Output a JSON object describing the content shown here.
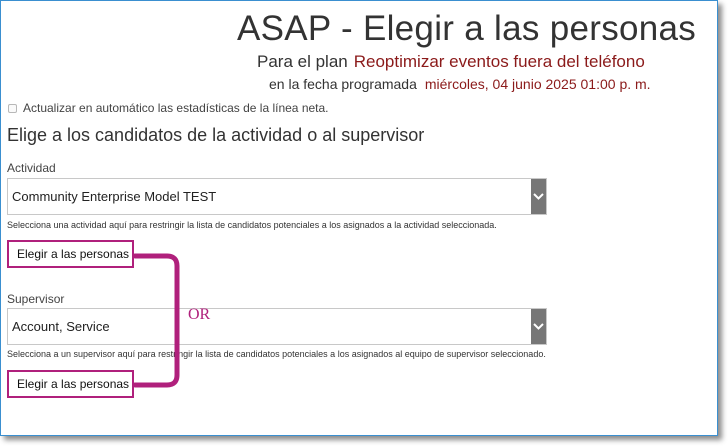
{
  "header": {
    "title": "ASAP - Elegir a las personas",
    "plan_label": "Para el plan",
    "plan_value": "Reoptimizar eventos fuera del teléfono",
    "date_label": "en la fecha programada",
    "date_value": "miércoles, 04 junio 2025 01:00 p. m."
  },
  "auto_update": {
    "label": "Actualizar en automático las estadísticas de la línea neta.",
    "checked": false
  },
  "section": {
    "heading": "Elige a los candidatos de la actividad o al supervisor"
  },
  "activity": {
    "label": "Actividad",
    "selected": "Community Enterprise Model TEST",
    "help": "Selecciona una actividad aquí para restringir la lista de candidatos potenciales a los asignados a la actividad seleccionada.",
    "button_label": "Elegir a las personas"
  },
  "supervisor": {
    "label": "Supervisor",
    "selected": "Account, Service",
    "help": "Selecciona a un supervisor aquí para restringir la lista de candidatos potenciales a los asignados al equipo de supervisor seleccionado.",
    "button_label": "Elegir a las personas"
  },
  "annotation": {
    "or_text": "OR",
    "color": "#b0207c"
  },
  "colors": {
    "plan_value": "#8b1a1a",
    "frame_border": "#3a8fd0",
    "select_arrow_bg": "#777777"
  }
}
